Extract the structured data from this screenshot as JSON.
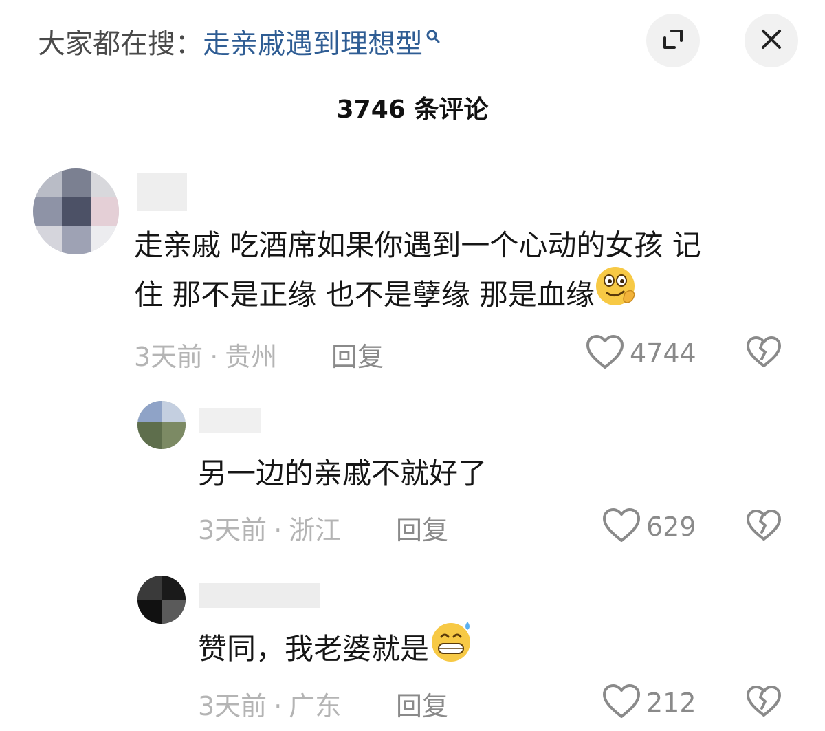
{
  "search": {
    "prefix": "大家都在搜：",
    "term": "走亲戚遇到理想型",
    "icon": "search-icon"
  },
  "header": {
    "comment_count": "3746 条评论",
    "expand_icon": "expand-icon",
    "close_icon": "close-icon"
  },
  "comments": [
    {
      "text_line1": "走亲戚 吃酒席如果你遇到一个心动的女孩 记",
      "text_line2": "住 那不是正缘 也不是孽缘 那是血缘",
      "emoji": "smirk-emoji",
      "time": "3天前",
      "dot": "·",
      "location": "贵州",
      "reply_label": "回复",
      "likes": "4744"
    },
    {
      "text": "另一边的亲戚不就好了",
      "time": "3天前",
      "dot": "·",
      "location": "浙江",
      "reply_label": "回复",
      "likes": "629"
    },
    {
      "text": "赞同，我老婆就是",
      "emoji": "grin-sweat-emoji",
      "time": "3天前",
      "dot": "·",
      "location": "广东",
      "reply_label": "回复",
      "likes": "212"
    }
  ],
  "colors": {
    "search_term": "#2f5d94",
    "meta_text": "#b4b4b4",
    "button_bg": "#f1f1f1"
  }
}
